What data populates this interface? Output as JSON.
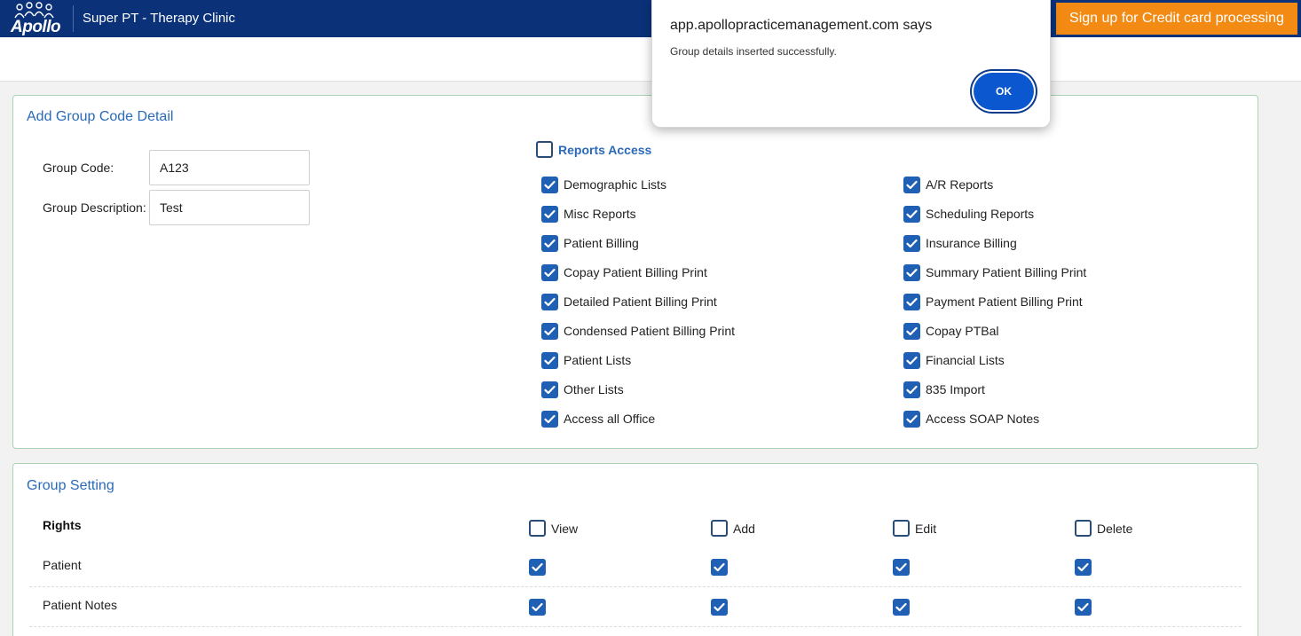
{
  "header": {
    "logo_text": "Apollo",
    "clinic_name": "Super PT - Therapy Clinic",
    "signup_label": "Sign up for Credit card processing"
  },
  "colors": {
    "header_bg": "#0b3278",
    "accent_orange": "#f28a14",
    "checkbox_blue": "#1f5fb4",
    "title_blue": "#2a6ab8"
  },
  "group_detail": {
    "title": "Add Group Code Detail",
    "group_code_label": "Group Code:",
    "group_code_value": "A123",
    "group_description_label": "Group Description:",
    "group_description_value": "Test",
    "reports_access_label": "Reports Access",
    "reports_access_checked": false,
    "reports_left": [
      {
        "label": "Demographic Lists",
        "checked": true
      },
      {
        "label": "Misc Reports",
        "checked": true
      },
      {
        "label": "Patient Billing",
        "checked": true
      },
      {
        "label": "Copay Patient Billing Print",
        "checked": true
      },
      {
        "label": "Detailed Patient Billing Print",
        "checked": true
      },
      {
        "label": "Condensed Patient Billing Print",
        "checked": true
      },
      {
        "label": "Patient Lists",
        "checked": true
      },
      {
        "label": "Other Lists",
        "checked": true
      },
      {
        "label": "Access all Office",
        "checked": true
      }
    ],
    "reports_right": [
      {
        "label": "A/R Reports",
        "checked": true
      },
      {
        "label": "Scheduling Reports",
        "checked": true
      },
      {
        "label": "Insurance Billing",
        "checked": true
      },
      {
        "label": "Summary Patient Billing Print",
        "checked": true
      },
      {
        "label": "Payment Patient Billing Print",
        "checked": true
      },
      {
        "label": "Copay PTBal",
        "checked": true
      },
      {
        "label": "Financial Lists",
        "checked": true
      },
      {
        "label": "835 Import",
        "checked": true
      },
      {
        "label": "Access SOAP Notes",
        "checked": true
      }
    ]
  },
  "group_setting": {
    "title": "Group Setting",
    "rights_label": "Rights",
    "columns": [
      {
        "label": "View",
        "checked": false
      },
      {
        "label": "Add",
        "checked": false
      },
      {
        "label": "Edit",
        "checked": false
      },
      {
        "label": "Delete",
        "checked": false
      }
    ],
    "rows": [
      {
        "label": "Patient",
        "view": true,
        "add": true,
        "edit": true,
        "delete": true
      },
      {
        "label": "Patient Notes",
        "view": true,
        "add": true,
        "edit": true,
        "delete": true
      }
    ]
  },
  "dialog": {
    "title": "app.apollopracticemanagement.com says",
    "message": "Group details inserted successfully.",
    "ok_label": "OK"
  }
}
